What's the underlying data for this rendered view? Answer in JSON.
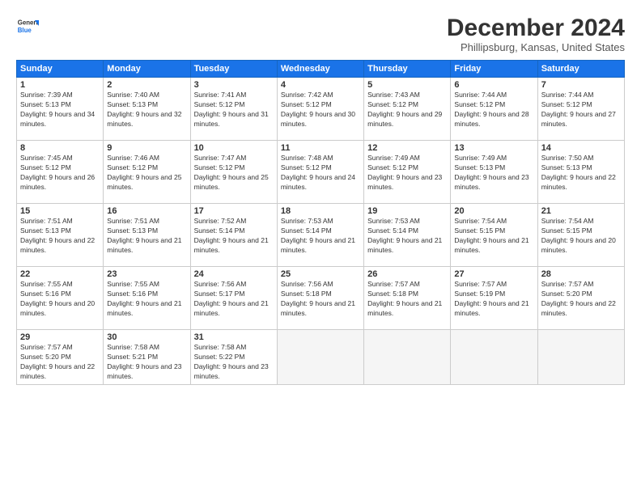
{
  "logo": {
    "general": "General",
    "blue": "Blue"
  },
  "title": "December 2024",
  "subtitle": "Phillipsburg, Kansas, United States",
  "weekdays": [
    "Sunday",
    "Monday",
    "Tuesday",
    "Wednesday",
    "Thursday",
    "Friday",
    "Saturday"
  ],
  "weeks": [
    [
      {
        "day": "1",
        "rise": "7:39 AM",
        "set": "5:13 PM",
        "daylight": "9 hours and 34 minutes."
      },
      {
        "day": "2",
        "rise": "7:40 AM",
        "set": "5:13 PM",
        "daylight": "9 hours and 32 minutes."
      },
      {
        "day": "3",
        "rise": "7:41 AM",
        "set": "5:12 PM",
        "daylight": "9 hours and 31 minutes."
      },
      {
        "day": "4",
        "rise": "7:42 AM",
        "set": "5:12 PM",
        "daylight": "9 hours and 30 minutes."
      },
      {
        "day": "5",
        "rise": "7:43 AM",
        "set": "5:12 PM",
        "daylight": "9 hours and 29 minutes."
      },
      {
        "day": "6",
        "rise": "7:44 AM",
        "set": "5:12 PM",
        "daylight": "9 hours and 28 minutes."
      },
      {
        "day": "7",
        "rise": "7:44 AM",
        "set": "5:12 PM",
        "daylight": "9 hours and 27 minutes."
      }
    ],
    [
      {
        "day": "8",
        "rise": "7:45 AM",
        "set": "5:12 PM",
        "daylight": "9 hours and 26 minutes."
      },
      {
        "day": "9",
        "rise": "7:46 AM",
        "set": "5:12 PM",
        "daylight": "9 hours and 25 minutes."
      },
      {
        "day": "10",
        "rise": "7:47 AM",
        "set": "5:12 PM",
        "daylight": "9 hours and 25 minutes."
      },
      {
        "day": "11",
        "rise": "7:48 AM",
        "set": "5:12 PM",
        "daylight": "9 hours and 24 minutes."
      },
      {
        "day": "12",
        "rise": "7:49 AM",
        "set": "5:12 PM",
        "daylight": "9 hours and 23 minutes."
      },
      {
        "day": "13",
        "rise": "7:49 AM",
        "set": "5:13 PM",
        "daylight": "9 hours and 23 minutes."
      },
      {
        "day": "14",
        "rise": "7:50 AM",
        "set": "5:13 PM",
        "daylight": "9 hours and 22 minutes."
      }
    ],
    [
      {
        "day": "15",
        "rise": "7:51 AM",
        "set": "5:13 PM",
        "daylight": "9 hours and 22 minutes."
      },
      {
        "day": "16",
        "rise": "7:51 AM",
        "set": "5:13 PM",
        "daylight": "9 hours and 21 minutes."
      },
      {
        "day": "17",
        "rise": "7:52 AM",
        "set": "5:14 PM",
        "daylight": "9 hours and 21 minutes."
      },
      {
        "day": "18",
        "rise": "7:53 AM",
        "set": "5:14 PM",
        "daylight": "9 hours and 21 minutes."
      },
      {
        "day": "19",
        "rise": "7:53 AM",
        "set": "5:14 PM",
        "daylight": "9 hours and 21 minutes."
      },
      {
        "day": "20",
        "rise": "7:54 AM",
        "set": "5:15 PM",
        "daylight": "9 hours and 21 minutes."
      },
      {
        "day": "21",
        "rise": "7:54 AM",
        "set": "5:15 PM",
        "daylight": "9 hours and 20 minutes."
      }
    ],
    [
      {
        "day": "22",
        "rise": "7:55 AM",
        "set": "5:16 PM",
        "daylight": "9 hours and 20 minutes."
      },
      {
        "day": "23",
        "rise": "7:55 AM",
        "set": "5:16 PM",
        "daylight": "9 hours and 21 minutes."
      },
      {
        "day": "24",
        "rise": "7:56 AM",
        "set": "5:17 PM",
        "daylight": "9 hours and 21 minutes."
      },
      {
        "day": "25",
        "rise": "7:56 AM",
        "set": "5:18 PM",
        "daylight": "9 hours and 21 minutes."
      },
      {
        "day": "26",
        "rise": "7:57 AM",
        "set": "5:18 PM",
        "daylight": "9 hours and 21 minutes."
      },
      {
        "day": "27",
        "rise": "7:57 AM",
        "set": "5:19 PM",
        "daylight": "9 hours and 21 minutes."
      },
      {
        "day": "28",
        "rise": "7:57 AM",
        "set": "5:20 PM",
        "daylight": "9 hours and 22 minutes."
      }
    ],
    [
      {
        "day": "29",
        "rise": "7:57 AM",
        "set": "5:20 PM",
        "daylight": "9 hours and 22 minutes."
      },
      {
        "day": "30",
        "rise": "7:58 AM",
        "set": "5:21 PM",
        "daylight": "9 hours and 23 minutes."
      },
      {
        "day": "31",
        "rise": "7:58 AM",
        "set": "5:22 PM",
        "daylight": "9 hours and 23 minutes."
      },
      null,
      null,
      null,
      null
    ]
  ]
}
